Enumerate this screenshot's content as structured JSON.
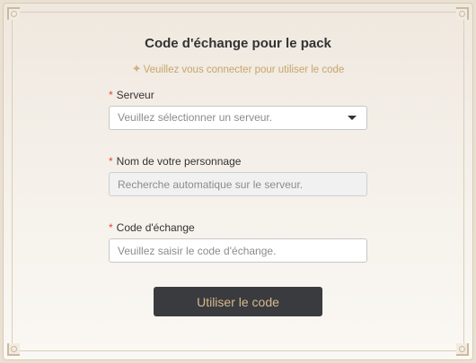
{
  "header": {
    "title": "Code d'échange pour le pack",
    "notice_icon": "sparkle-star-icon",
    "notice": "Veuillez vous connecter pour utiliser le code"
  },
  "form": {
    "required_mark": "*",
    "server": {
      "label": "Serveur",
      "placeholder": "Veuillez sélectionner un serveur."
    },
    "character": {
      "label": "Nom de votre personnage",
      "placeholder": "Recherche automatique sur le serveur."
    },
    "code": {
      "label": "Code d'échange",
      "placeholder": "Veuillez saisir le code d'échange."
    },
    "submit_label": "Utiliser le code"
  },
  "colors": {
    "accent_gold": "#c9a56a",
    "button_bg": "#3a3b3f",
    "button_text": "#d7b98d",
    "required": "#e0453b"
  }
}
